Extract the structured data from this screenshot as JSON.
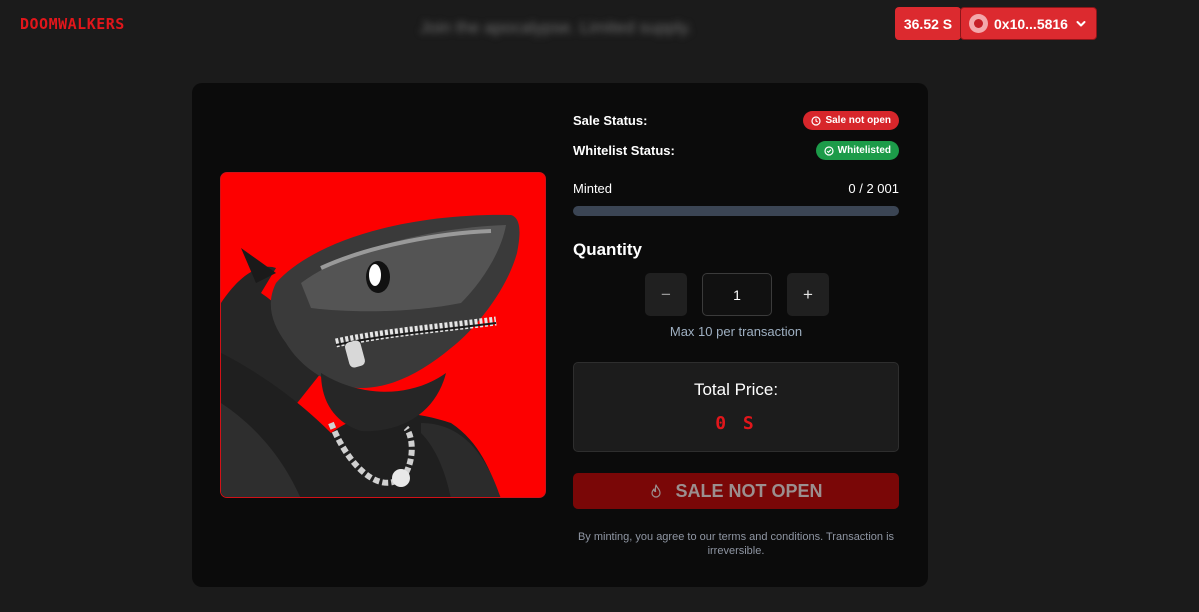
{
  "header": {
    "logo": "DOOMWALKERS",
    "tagline": "Join the apocalypse. Limited supply.",
    "balance": "36.52 S",
    "wallet_address": "0x10...5816"
  },
  "status": {
    "sale_label": "Sale Status:",
    "sale_badge": "Sale not open",
    "whitelist_label": "Whitelist Status:",
    "whitelist_badge": "Whitelisted"
  },
  "mint": {
    "minted_label": "Minted",
    "minted_value": "0 / 2 001",
    "progress_fraction": 0
  },
  "quantity": {
    "title": "Quantity",
    "minus": "−",
    "plus": "+",
    "value": "1",
    "max_note": "Max 10 per transaction"
  },
  "price": {
    "label": "Total Price:",
    "value": "0 S"
  },
  "action": {
    "button_label": "SALE NOT OPEN"
  },
  "terms": "By minting, you agree to our terms and conditions. Transaction is irreversible.",
  "colors": {
    "accent": "#e1161b",
    "background": "#1b1b1b",
    "card": "#0b0b0b",
    "success": "#1c9b49",
    "progress_track": "#3b4554"
  },
  "icons": {
    "sale_badge": "clock-icon",
    "whitelist_badge": "check-circle-icon",
    "wallet": "avatar-icon",
    "wallet_menu": "chevron-down-icon",
    "sale_button": "flame-icon"
  }
}
